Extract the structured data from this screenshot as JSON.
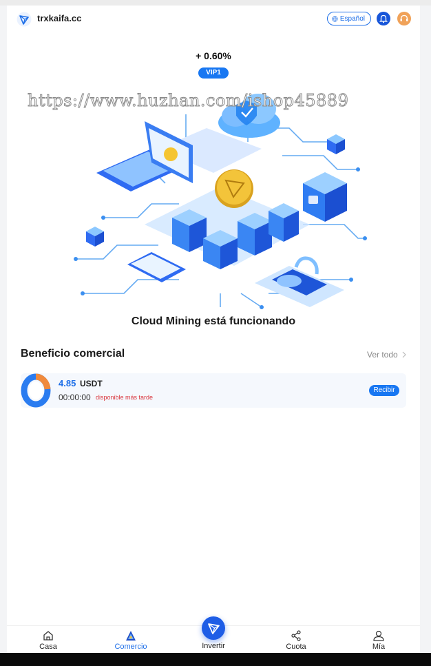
{
  "header": {
    "brand": "trxkaifa.cc",
    "language_label": "Español",
    "icons": [
      "tron-logo-icon",
      "globe-icon",
      "bell-icon",
      "support-icon"
    ]
  },
  "hero": {
    "rate": "+ 0.60%",
    "vip_badge": "VIP1",
    "watermark": "https://www.huzhan.com/ishop45889",
    "status": "Cloud Mining está funcionando"
  },
  "section": {
    "title": "Beneficio comercial",
    "view_all": "Ver todo"
  },
  "mining_card": {
    "amount": "4.85",
    "unit": "USDT",
    "timer": "00:00:00",
    "availability": "disponible más tarde",
    "claim_button": "Recibir"
  },
  "tabs": {
    "home": "Casa",
    "trade": "Comercio",
    "invest": "Invertir",
    "share": "Cuota",
    "mine": "Mía",
    "active": "Comercio"
  },
  "colors": {
    "accent": "#1877f2",
    "alert": "#d9363e",
    "support": "#f0a259"
  }
}
